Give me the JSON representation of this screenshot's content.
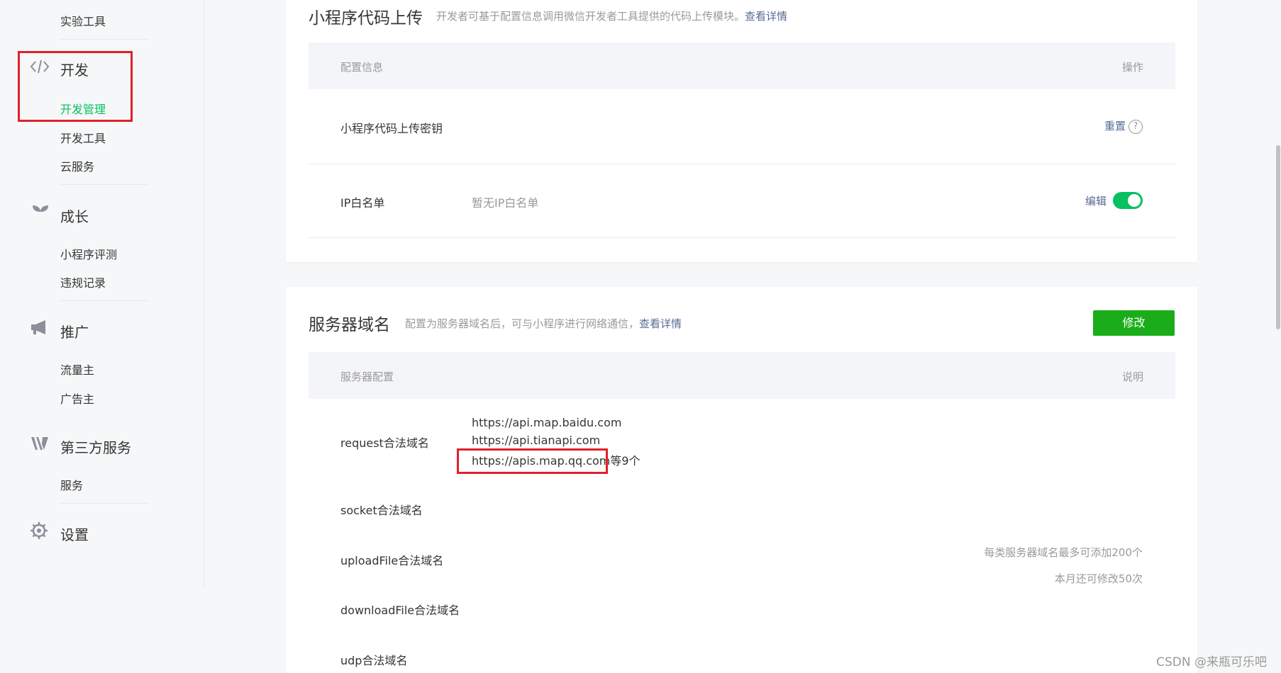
{
  "sidebar": {
    "top_item": "实验工具",
    "groups": [
      {
        "label": "开发",
        "icon": "code-icon",
        "items": [
          "开发管理",
          "开发工具",
          "云服务"
        ],
        "active_item": "开发管理"
      },
      {
        "label": "成长",
        "icon": "sprout-icon",
        "items": [
          "小程序评测",
          "违规记录"
        ]
      },
      {
        "label": "推广",
        "icon": "megaphone-icon",
        "items": [
          "流量主",
          "广告主"
        ]
      },
      {
        "label": "第三方服务",
        "icon": "third-party-icon",
        "items": [
          "服务"
        ]
      },
      {
        "label": "设置",
        "icon": "gear-icon",
        "items": []
      }
    ]
  },
  "upload_card": {
    "title": "小程序代码上传",
    "desc": "开发者可基于配置信息调用微信开发者工具提供的代码上传模块。",
    "desc_link": "查看详情",
    "header": {
      "col1": "配置信息",
      "col2": "操作"
    },
    "rows": [
      {
        "label": "小程序代码上传密钥",
        "value": "",
        "action": "重置",
        "help": "?"
      },
      {
        "label": "IP白名单",
        "value": "暂无IP白名单",
        "action": "编辑",
        "toggle_on": true
      }
    ]
  },
  "server_card": {
    "title": "服务器域名",
    "desc": "配置为服务器域名后，可与小程序进行网络通信，",
    "desc_link": "查看详情",
    "edit_button": "修改",
    "header": {
      "col1": "服务器配置",
      "col2": "说明"
    },
    "request": {
      "label": "request合法域名",
      "domains": [
        "https://api.map.baidu.com",
        "https://api.tianapi.com",
        "https://apis.map.qq.com"
      ],
      "suffix": "等9个"
    },
    "socket_label": "socket合法域名",
    "upload_label": "uploadFile合法域名",
    "download_label": "downloadFile合法域名",
    "udp_label": "udp合法域名",
    "note_line1": "每类服务器域名最多可添加200个",
    "note_line2": "本月还可修改50次"
  },
  "watermark": "CSDN @来瓶可乐吧",
  "colors": {
    "accent_green": "#07c160",
    "button_green": "#1aad19",
    "link": "#576b95",
    "annotation_red": "#e0202b"
  }
}
